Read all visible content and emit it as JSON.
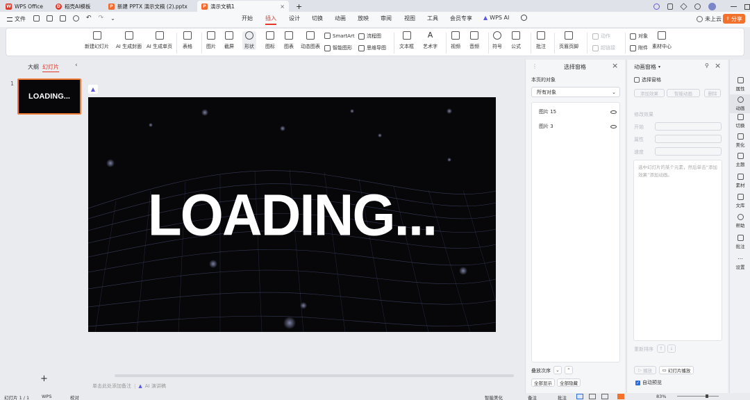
{
  "titlebar": {
    "tabs": [
      {
        "label": "WPS Office"
      },
      {
        "label": "稻壳AI模板"
      },
      {
        "label": "新建 PPTX 演示文稿 (2).pptx"
      },
      {
        "label": "演示文稿1"
      }
    ],
    "new_tab": "+"
  },
  "menu": {
    "file": "文件",
    "items": [
      "开始",
      "插入",
      "设计",
      "切换",
      "动画",
      "放映",
      "审阅",
      "视图",
      "工具",
      "会员专享",
      "WPS AI"
    ],
    "cloud": "未上云",
    "share": "分享"
  },
  "ribbon": {
    "new_slide": "新建幻灯片",
    "ai_cover": "AI 生成封面",
    "ai_page": "AI 生成单页",
    "table": "表格",
    "picture": "图片",
    "screenshot": "截屏",
    "shape": "形状",
    "icon": "图标",
    "chart": "图表",
    "dynamic_chart": "动态图表",
    "smartart": "SmartArt",
    "smart_graph": "智能图形",
    "flowchart": "流程图",
    "mindmap": "思维导图",
    "textbox": "文本框",
    "wordart": "艺术字",
    "video": "视频",
    "audio": "音频",
    "symbol": "符号",
    "formula": "公式",
    "comment": "批注",
    "header_footer": "页眉页脚",
    "action": "动作",
    "hyperlink": "超链接",
    "object": "对象",
    "attachment": "附件",
    "material": "素材中心"
  },
  "left_panel": {
    "tab_outline": "大纲",
    "tab_slides": "幻灯片",
    "slide_number": "1",
    "thumb_text": "LOADING...",
    "add": "+"
  },
  "slide": {
    "title": "LOADING..."
  },
  "notes": {
    "placeholder": "单击此处添加备注",
    "ai_speech": "AI 演讲稿"
  },
  "selection_pane": {
    "title": "选择窗格",
    "section": "本页的对象",
    "dropdown": "所有对象",
    "objects": [
      "图片 15",
      "图片 3"
    ],
    "order_label": "叠放次序",
    "show_all": "全部显示",
    "hide_all": "全部隐藏"
  },
  "animation_pane": {
    "title": "动画窗格",
    "select_pane": "选择窗格",
    "add_effect": "添加效果",
    "smart_anim": "智能动画",
    "delete": "删除",
    "modify": "修改效果",
    "start": "开始",
    "property": "属性",
    "speed": "速度",
    "hint": "选中幻灯片的某个元素，然后单击“添加效果”添加动画。",
    "reorder": "重新排序",
    "play": "播放",
    "slideshow": "幻灯片播放",
    "autopreview": "自动预览"
  },
  "right_sidebar": [
    "属性",
    "动画",
    "切换",
    "美化",
    "主题",
    "素材",
    "文库",
    "帮助",
    "批注",
    "设置"
  ],
  "status": {
    "slide_count": "幻灯片 1 / 1",
    "wps": "WPS",
    "proof": "校对",
    "beautify": "智能美化",
    "notes": "备注",
    "comment": "批注",
    "zoom": "83%"
  },
  "colors": {
    "accent": "#e0392b",
    "share_bg": "#f3712a",
    "slide_bg": "#07070a"
  }
}
